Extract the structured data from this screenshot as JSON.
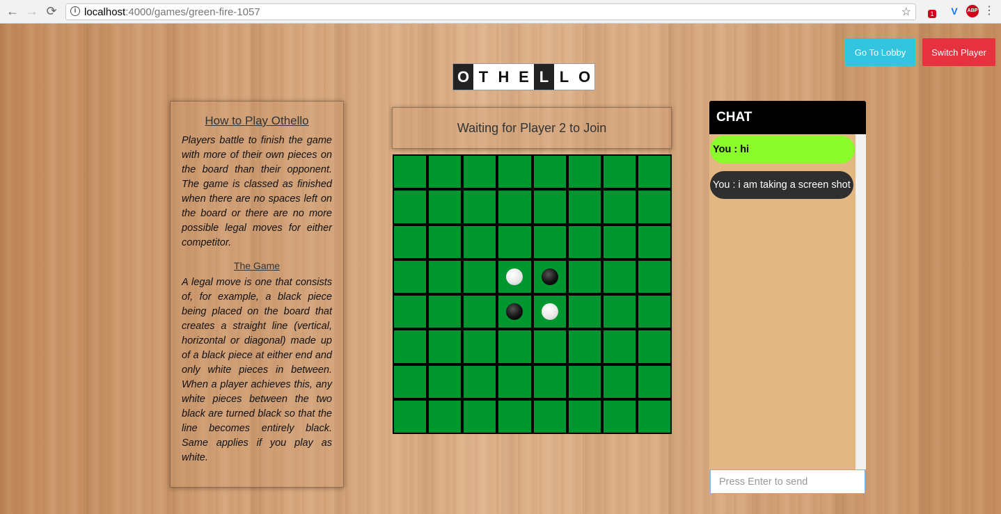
{
  "browser": {
    "url_host": "localhost",
    "url_path": ":4000/games/green-fire-1057",
    "nav": {
      "back": "←",
      "forward": "→",
      "reload": "⟳"
    },
    "extensions": [
      {
        "name": "extension-badge-icon",
        "label": "1",
        "color": "#d0021b"
      },
      {
        "name": "v-extension-icon",
        "label": "V",
        "color": "#1a73e8"
      },
      {
        "name": "adblock-icon",
        "label": "ABP",
        "color": "#d0021b"
      }
    ]
  },
  "header": {
    "lobby_button": "Go To Lobby",
    "switch_button": "Switch Player",
    "logo_letters": [
      "O",
      "T",
      "H",
      "E",
      "L",
      "L",
      "O"
    ]
  },
  "howto": {
    "title": "How to Play Othello",
    "intro": "Players battle to finish the game with more of their own pieces on the board than their opponent. The game is classed as finished when there are no spaces left on the board or there are no more possible legal moves for either competitor.",
    "subtitle": "The Game",
    "rules": "A legal move is one that consists of, for example, a black piece being placed on the board that creates a straight line (vertical, horizontal or diagonal) made up of a black piece at either end and only white pieces in between. When a player achieves this, any white pieces between the two black are turned black so that the line becomes entirely black. Same applies if you play as white."
  },
  "game": {
    "status": "Waiting for Player 2 to Join",
    "board": [
      [
        0,
        0,
        0,
        0,
        0,
        0,
        0,
        0
      ],
      [
        0,
        0,
        0,
        0,
        0,
        0,
        0,
        0
      ],
      [
        0,
        0,
        0,
        0,
        0,
        0,
        0,
        0
      ],
      [
        0,
        0,
        0,
        "W",
        "B",
        0,
        0,
        0
      ],
      [
        0,
        0,
        0,
        "B",
        "W",
        0,
        0,
        0
      ],
      [
        0,
        0,
        0,
        0,
        0,
        0,
        0,
        0
      ],
      [
        0,
        0,
        0,
        0,
        0,
        0,
        0,
        0
      ],
      [
        0,
        0,
        0,
        0,
        0,
        0,
        0,
        0
      ]
    ]
  },
  "chat": {
    "title": "CHAT",
    "messages": [
      {
        "text": "You : hi"
      },
      {
        "text": "You : i am taking a screen shot"
      }
    ],
    "input_placeholder": "Press Enter to send"
  },
  "colors": {
    "board_green": "#00962f",
    "lobby_button": "#33c5e0",
    "switch_button": "#e5323e",
    "own_message": "#8bfc2b",
    "other_message": "#2f2f2f"
  }
}
